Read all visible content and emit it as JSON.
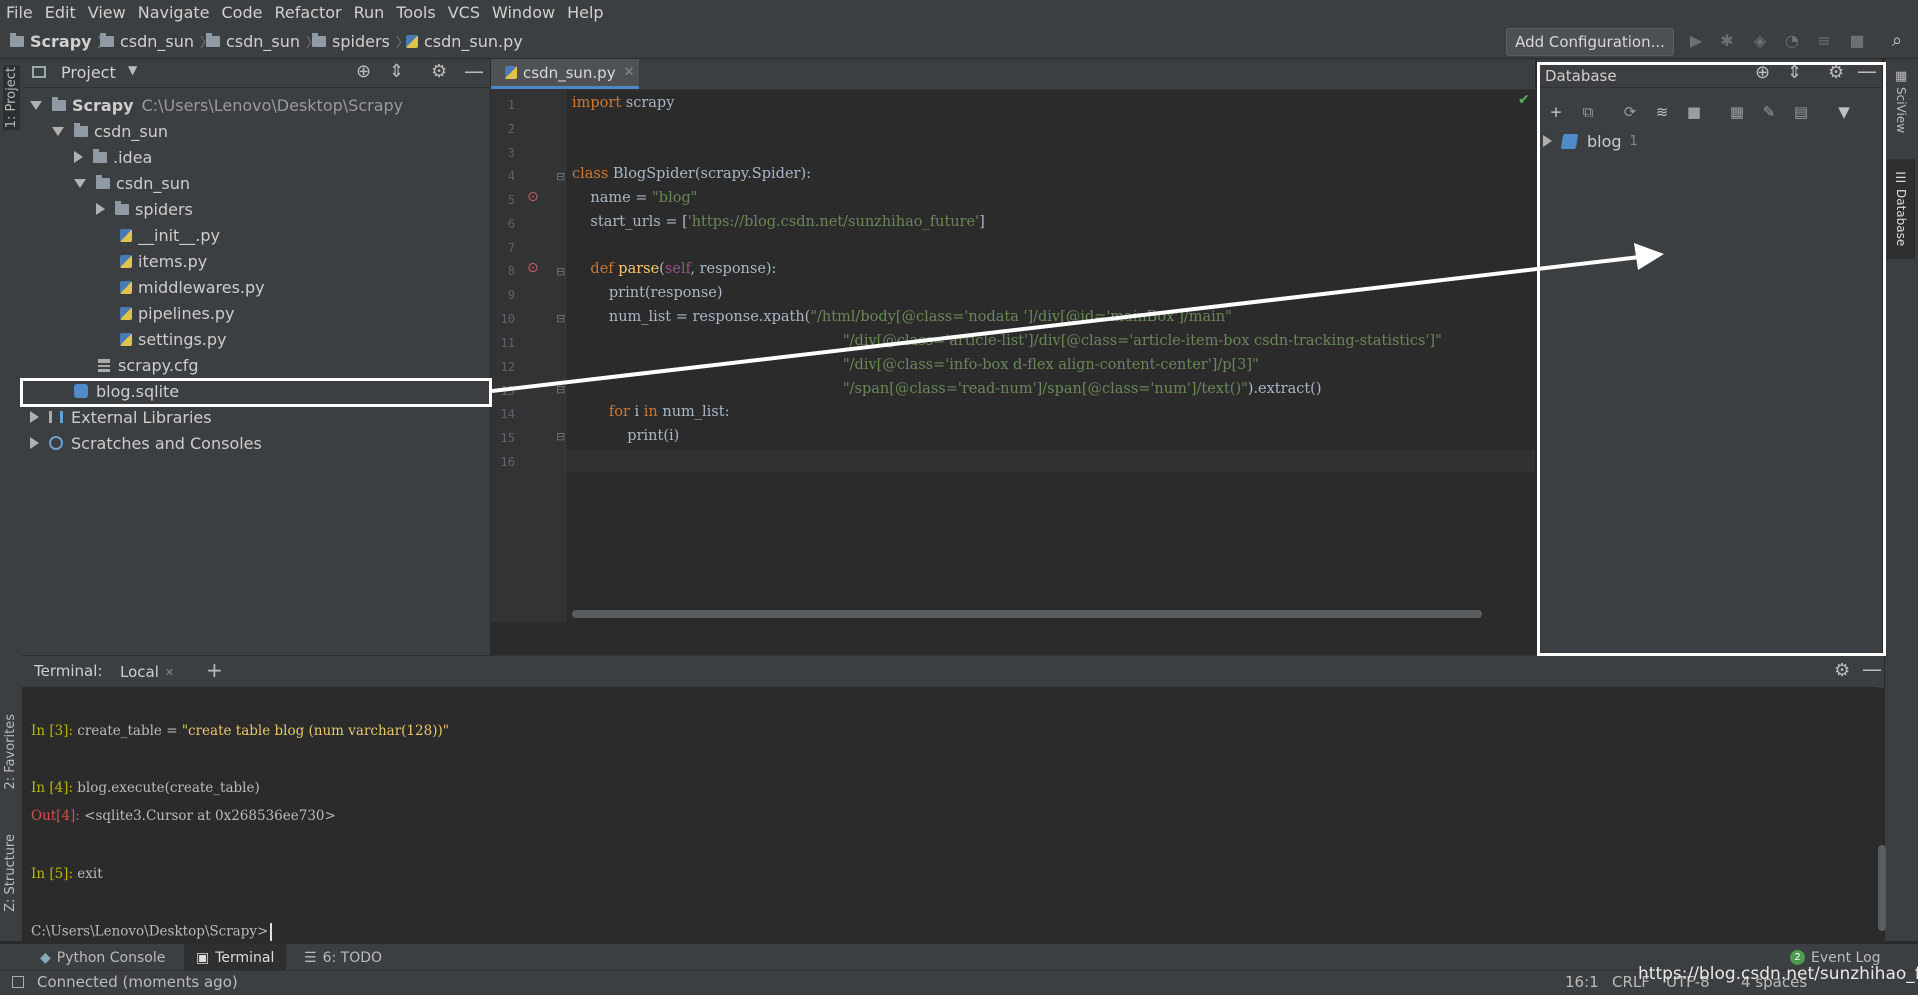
{
  "menu": [
    "File",
    "Edit",
    "View",
    "Navigate",
    "Code",
    "Refactor",
    "Run",
    "Tools",
    "VCS",
    "Window",
    "Help"
  ],
  "breadcrumb": [
    "Scrapy",
    "csdn_sun",
    "csdn_sun",
    "spiders",
    "csdn_sun.py"
  ],
  "toolbar": {
    "add_configuration": "Add Configuration..."
  },
  "left_stripe": {
    "project": "1: Project",
    "favorites": "2: Favorites",
    "structure": "Z: Structure"
  },
  "right_stripe": {
    "sciview": "SciView",
    "database": "Database"
  },
  "project": {
    "header": "Project",
    "root_name": "Scrapy",
    "root_path": "C:\\Users\\Lenovo\\Desktop\\Scrapy",
    "items": [
      "csdn_sun",
      ".idea",
      "csdn_sun",
      "spiders",
      "__init__.py",
      "items.py",
      "middlewares.py",
      "pipelines.py",
      "settings.py",
      "scrapy.cfg",
      "blog.sqlite",
      "External Libraries",
      "Scratches and Consoles"
    ]
  },
  "editor": {
    "tab": "csdn_sun.py",
    "line_numbers": [
      "1",
      "2",
      "3",
      "4",
      "5",
      "6",
      "7",
      "8",
      "9",
      "10",
      "11",
      "12",
      "13",
      "14",
      "15",
      "16"
    ]
  },
  "code": {
    "l1_kw": "import",
    "l1_rest": " scrapy",
    "l4_kw": "class",
    "l4_rest": " BlogSpider(scrapy.Spider):",
    "l5_a": "    name = ",
    "l5_s": "\"blog\"",
    "l6_a": "    start_urls = [",
    "l6_s": "'https://blog.csdn.net/sunzhihao_future'",
    "l6_b": "]",
    "l8_kw": "    def ",
    "l8_fn": "parse",
    "l8_p": "(",
    "l8_self": "self",
    "l8_rest": ", response):",
    "l9": "        print(response)",
    "l10_a": "        num_list = response.xpath(",
    "l10_s": "\"/html/body[@class='nodata ']/div[@id='mainBox']/main\"",
    "l11_s": "\"/div[@class='article-list']/div[@class='article-item-box csdn-tracking-statistics']\"",
    "l12_s": "\"/div[@class='info-box d-flex align-content-center']/p[3]\"",
    "l13_s": "\"/span[@class='read-num']/span[@class='num']/text()\"",
    "l13_b": ").extract()",
    "l14_kw": "        for",
    "l14_a": " i ",
    "l14_kw2": "in",
    "l14_b": " num_list:",
    "l15": "            print(i)"
  },
  "database": {
    "header": "Database",
    "datasource": "blog",
    "datasource_count": "1"
  },
  "terminal": {
    "label": "Terminal:",
    "tab": "Local",
    "in3_prompt": "In [3]: ",
    "in3_code": "create_table = ",
    "in3_str": "\"create table blog (num varchar(128))\"",
    "in4_prompt": "In [4]: ",
    "in4_code": "blog.execute(create_table)",
    "out4_prompt": "Out[4]: ",
    "out4_val": "<sqlite3.Cursor at 0x268536ee730>",
    "in5_prompt": "In [5]: ",
    "in5_code": "exit",
    "cwd": "C:\\Users\\Lenovo\\Desktop\\Scrapy>"
  },
  "bottom_tabs": [
    "Python Console",
    "Terminal",
    "6: TODO"
  ],
  "event_log": {
    "label": "Event Log",
    "count": "2"
  },
  "status": {
    "message": "Connected (moments ago)",
    "position": "16:1",
    "line_sep": "CRLF",
    "encoding": "UTF-8",
    "indent": "4 spaces",
    "watermark": "https://blog.csdn.net/sunzhihao_future"
  },
  "colors": {
    "background": "#2b2b2b",
    "panel": "#3c3f41",
    "keyword": "#cc7832",
    "string": "#6a8759",
    "accent": "#4a88c7"
  }
}
